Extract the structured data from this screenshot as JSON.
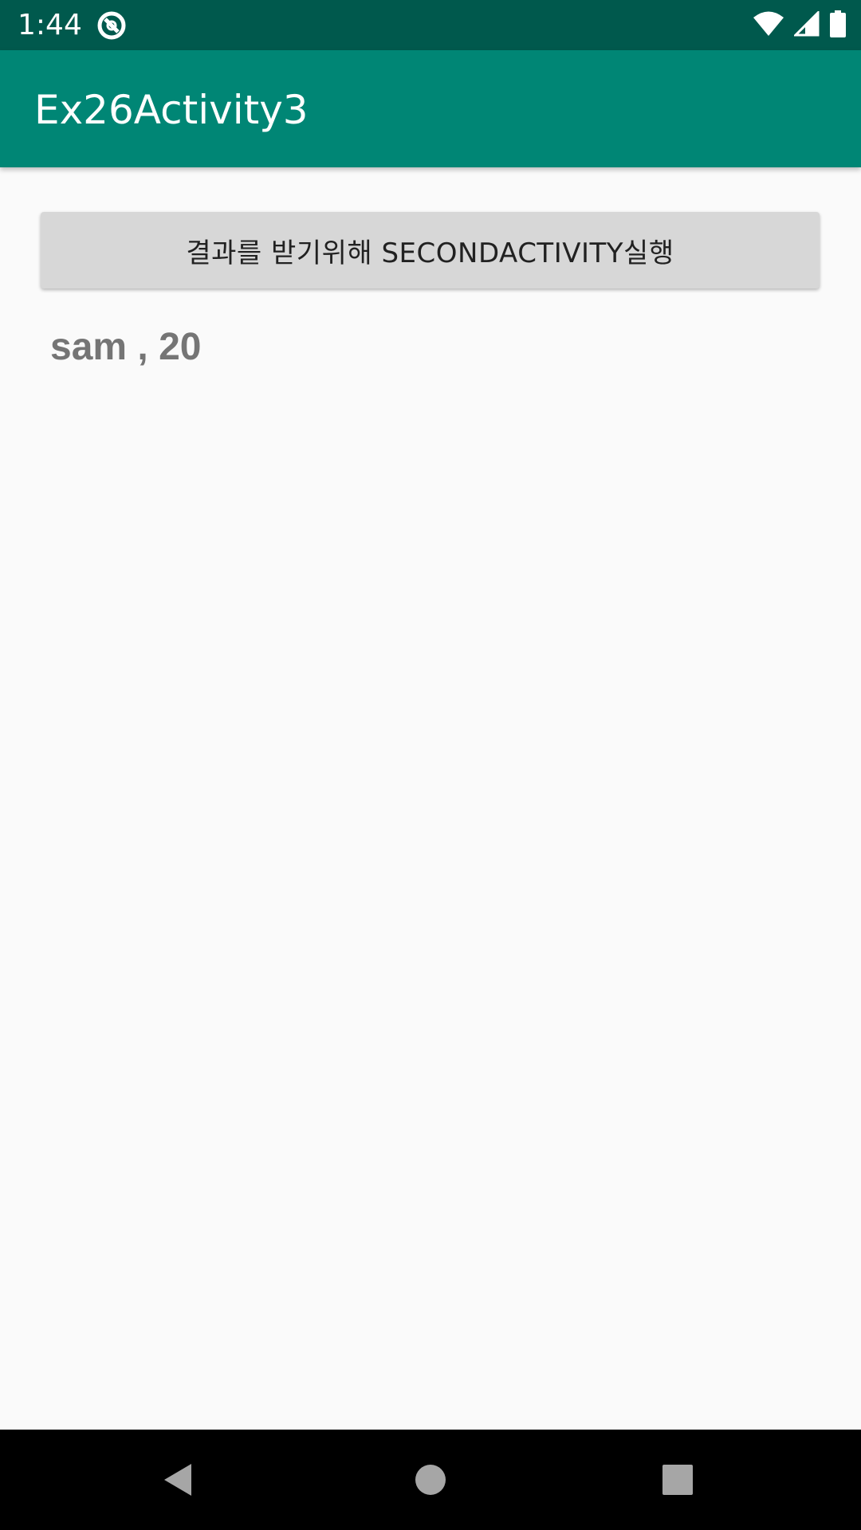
{
  "status_bar": {
    "time": "1:44",
    "icons": [
      "notification-icon",
      "wifi-icon",
      "cell-signal-icon",
      "battery-icon"
    ]
  },
  "app_bar": {
    "title": "Ex26Activity3"
  },
  "main": {
    "button_label": "결과를 받기위해 SECONDACTIVITY실행",
    "result_text": "sam , 20"
  },
  "nav_bar": {
    "icons": [
      "back-icon",
      "home-icon",
      "recents-icon"
    ]
  },
  "colors": {
    "status_bar": "#00594d",
    "app_bar": "#008675",
    "background": "#fafafa",
    "button": "#d7d7d7",
    "result_text": "#757575"
  }
}
